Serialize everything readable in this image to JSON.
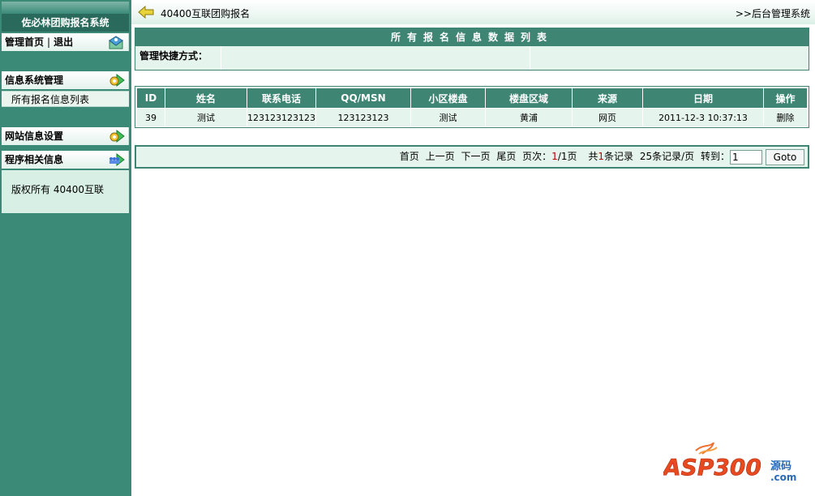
{
  "sidebar": {
    "title": "佐必林团购报名系统",
    "home_label": "管理首页",
    "separator": "|",
    "logout_label": "退出",
    "info_mgmt": "信息系统管理",
    "all_entries": "所有报名信息列表",
    "site_settings": "网站信息设置",
    "program_info": "程序相关信息",
    "copyright": "版权所有 40400互联"
  },
  "topbar": {
    "site_name": "40400互联团购报名",
    "admin_link": ">>后台管理系统"
  },
  "panel": {
    "title": "所有报名信息数据列表",
    "shortcut_label": "管理快捷方式："
  },
  "table": {
    "headers": [
      "ID",
      "姓名",
      "联系电话",
      "QQ/MSN",
      "小区楼盘",
      "楼盘区域",
      "来源",
      "日期",
      "操作"
    ],
    "rows": [
      [
        "39",
        "测试",
        "123123123123",
        "123123123",
        "测试",
        "黄浦",
        "网页",
        "2011-12-3 10:37:13",
        "删除"
      ]
    ]
  },
  "pager": {
    "first": "首页",
    "prev": "上一页",
    "next": "下一页",
    "last": "尾页",
    "page_prefix": "页次：",
    "current": "1",
    "page_total": "/1页",
    "total_prefix": "共",
    "total_count": "1",
    "total_suffix": "条记录",
    "per_page": "25条记录/页",
    "goto_label": "转到：",
    "goto_value": "1",
    "goto_button": "Goto"
  },
  "watermark": {
    "brand": "ASP300",
    "suffix": "源码",
    "domain": ".com"
  },
  "colors": {
    "sidebar_bg": "#3b8a78",
    "header_bg": "#3f8574",
    "row_bg": "#e6f4ee",
    "accent_red": "#c00000"
  }
}
